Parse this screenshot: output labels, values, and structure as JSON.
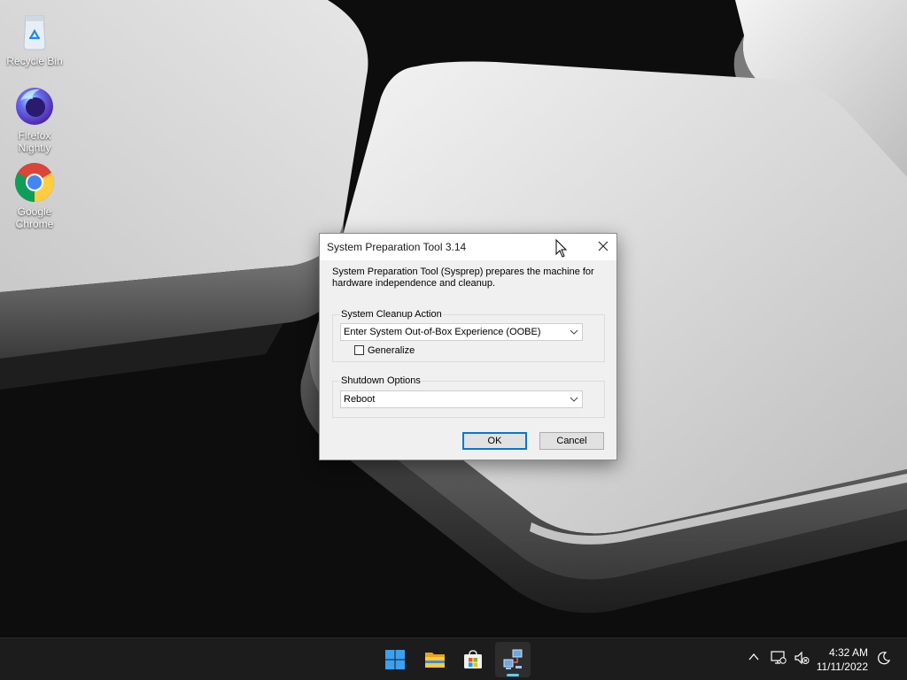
{
  "desktop": {
    "icons": [
      {
        "label": "Recycle Bin",
        "icon": "recycle-bin-icon"
      },
      {
        "label": "Firefox Nightly",
        "label_line1": "Firefox",
        "label_line2": "Nightly",
        "icon": "firefox-nightly-icon"
      },
      {
        "label": "Google Chrome",
        "label_line1": "Google",
        "label_line2": "Chrome",
        "icon": "chrome-icon"
      }
    ]
  },
  "dialog": {
    "title": "System Preparation Tool 3.14",
    "description": "System Preparation Tool (Sysprep) prepares the machine for hardware independence and cleanup.",
    "cleanup_group": {
      "legend": "System Cleanup Action",
      "selected": "Enter System Out-of-Box Experience (OOBE)",
      "generalize_label": "Generalize",
      "generalize_checked": false
    },
    "shutdown_group": {
      "legend": "Shutdown Options",
      "selected": "Reboot"
    },
    "ok_label": "OK",
    "cancel_label": "Cancel"
  },
  "taskbar": {
    "apps": [
      {
        "name": "start",
        "icon": "windows-logo-icon"
      },
      {
        "name": "file-explorer",
        "icon": "folder-icon"
      },
      {
        "name": "microsoft-store",
        "icon": "store-icon"
      },
      {
        "name": "sysprep",
        "icon": "network-computers-icon",
        "active": true
      }
    ],
    "tray": {
      "time": "4:32 AM",
      "date": "11/11/2022"
    }
  },
  "colors": {
    "accent": "#0078d7",
    "taskbar_bg": "#1c1c1c",
    "dialog_bg": "#f0f0f0",
    "active_indicator": "#60cdff"
  }
}
